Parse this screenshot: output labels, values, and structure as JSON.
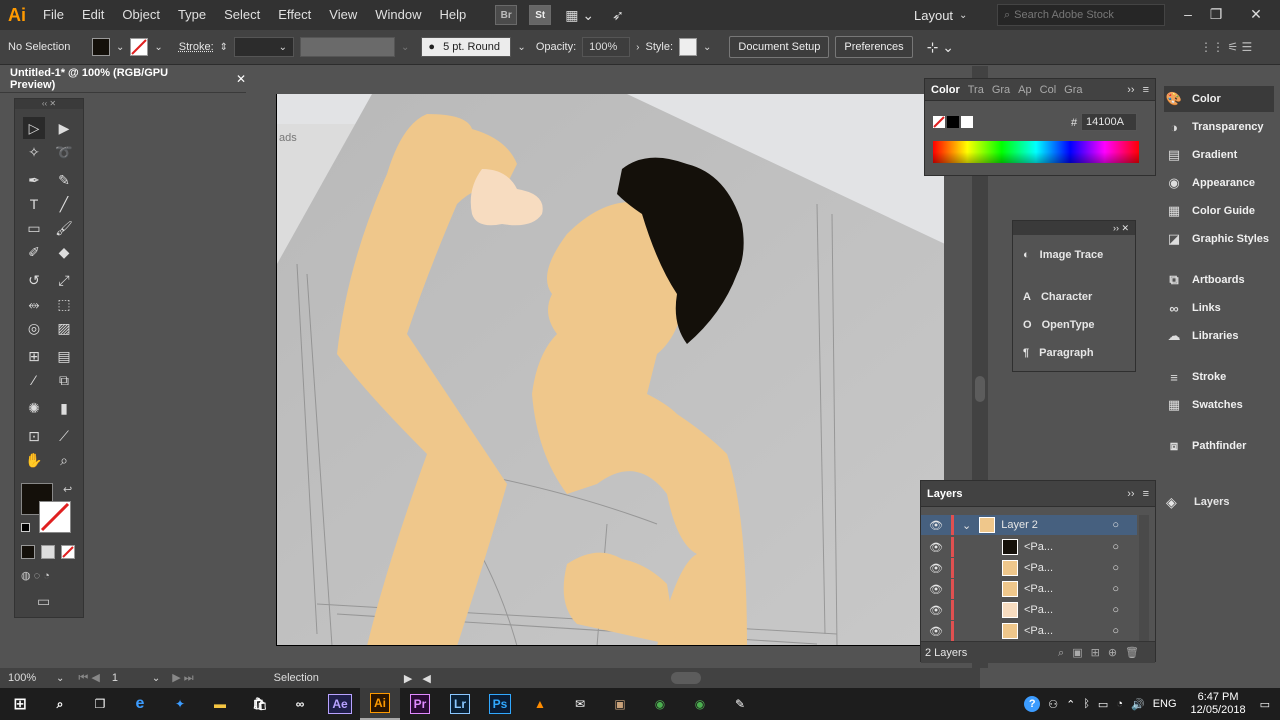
{
  "app": {
    "logo": "Ai",
    "window_title": "Untitled-1* @ 100% (RGB/GPU Preview)"
  },
  "menu": [
    "File",
    "Edit",
    "Object",
    "Type",
    "Select",
    "Effect",
    "View",
    "Window",
    "Help"
  ],
  "bridge_buttons": [
    "Br",
    "St"
  ],
  "workspace": "Layout",
  "search": {
    "placeholder": "Search Adobe Stock"
  },
  "control": {
    "selection": "No Selection",
    "stroke_label": "Stroke:",
    "brush": "5 pt. Round",
    "opacity_label": "Opacity:",
    "opacity_value": "100%",
    "style_label": "Style:",
    "document_setup": "Document Setup",
    "preferences": "Preferences"
  },
  "color_panel": {
    "tabs": [
      "Color",
      "Tra",
      "Gra",
      "Ap",
      "Col",
      "Gra"
    ],
    "hex_label": "#",
    "hex_value": "14100A"
  },
  "floating_panel": {
    "items": [
      "Image Trace",
      "Character",
      "OpenType",
      "Paragraph"
    ]
  },
  "dock": {
    "items": [
      "Color",
      "Transparency",
      "Gradient",
      "Appearance",
      "Color Guide",
      "Graphic Styles",
      "Artboards",
      "Links",
      "Libraries",
      "Stroke",
      "Swatches",
      "Pathfinder"
    ],
    "layers_item": "Layers"
  },
  "layers_panel": {
    "title": "Layers",
    "layer_name": "Layer 2",
    "sublayers": [
      "<Pa...",
      "<Pa...",
      "<Pa...",
      "<Pa...",
      "<Pa..."
    ],
    "footer": "2 Layers"
  },
  "artboard": {
    "bg_text": "ads"
  },
  "status": {
    "zoom": "100%",
    "artboard_num": "1",
    "tool": "Selection"
  },
  "taskbar": {
    "apps": [
      "Ae",
      "Ai",
      "Pr",
      "Lr",
      "Ps"
    ],
    "lang": "ENG",
    "time": "6:47 PM",
    "date": "12/05/2018"
  },
  "colors": {
    "skin": "#efc78b",
    "hair": "#14100a",
    "fill": "#14100a",
    "accent": "#ff9a00"
  }
}
